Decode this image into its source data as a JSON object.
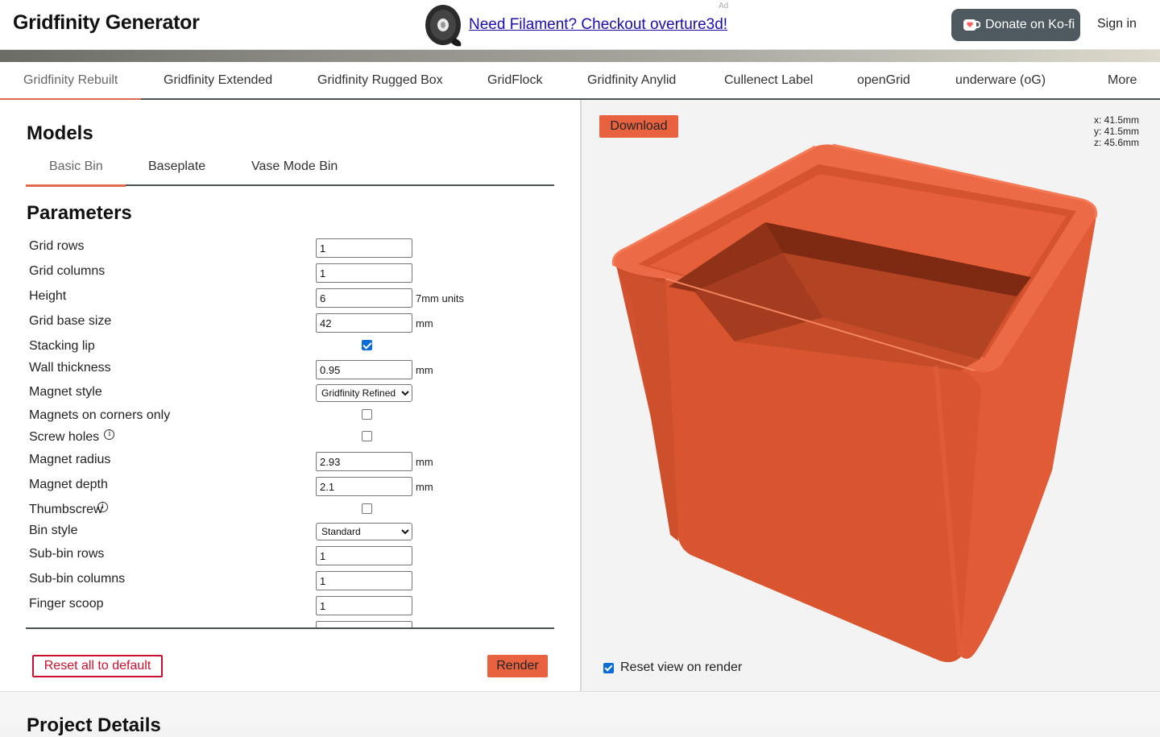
{
  "header": {
    "brand": "Gridfinity Generator",
    "ad_label": "Ad",
    "ad_link": "Need Filament? Checkout overture3d!",
    "kofi_label": "Donate on Ko-fi",
    "signin": "Sign in"
  },
  "nav": {
    "items": [
      {
        "label": "Gridfinity Rebuilt",
        "active": true
      },
      {
        "label": "Gridfinity Extended"
      },
      {
        "label": "Gridfinity Rugged Box"
      },
      {
        "label": "GridFlock"
      },
      {
        "label": "Gridfinity Anylid"
      },
      {
        "label": "Cullenect Label"
      },
      {
        "label": "openGrid"
      },
      {
        "label": "underware (oG)"
      },
      {
        "label": "More"
      }
    ]
  },
  "models": {
    "title": "Models",
    "tabs": [
      {
        "label": "Basic Bin",
        "active": true
      },
      {
        "label": "Baseplate"
      },
      {
        "label": "Vase Mode Bin"
      }
    ]
  },
  "parameters": {
    "title": "Parameters",
    "rows": [
      {
        "label": "Grid rows",
        "type": "text",
        "value": "1"
      },
      {
        "label": "Grid columns",
        "type": "text",
        "value": "1"
      },
      {
        "label": "Height",
        "type": "text",
        "value": "6",
        "unit": "7mm units"
      },
      {
        "label": "Grid base size",
        "type": "text",
        "value": "42",
        "unit": "mm"
      },
      {
        "label": "Stacking lip",
        "type": "checkbox",
        "checked": true
      },
      {
        "label": "Wall thickness",
        "type": "text",
        "value": "0.95",
        "unit": "mm"
      },
      {
        "label": "Magnet style",
        "type": "select",
        "value": "Gridfinity Refined"
      },
      {
        "label": "Magnets on corners only",
        "type": "checkbox",
        "checked": false
      },
      {
        "label": "Screw holes",
        "type": "checkbox",
        "checked": false,
        "info": true
      },
      {
        "label": "Magnet radius",
        "type": "text",
        "value": "2.93",
        "unit": "mm"
      },
      {
        "label": "Magnet depth",
        "type": "text",
        "value": "2.1",
        "unit": "mm"
      },
      {
        "label": "Thumbscrew",
        "type": "checkbox",
        "checked": false,
        "info": true
      },
      {
        "label": "Bin style",
        "type": "select",
        "value": "Standard"
      },
      {
        "label": "Sub-bin rows",
        "type": "text",
        "value": "1"
      },
      {
        "label": "Sub-bin columns",
        "type": "text",
        "value": "1"
      },
      {
        "label": "Finger scoop",
        "type": "text",
        "value": "1"
      },
      {
        "label": "",
        "type": "text",
        "value": ""
      }
    ],
    "reset_label": "Reset all to default",
    "render_label": "Render"
  },
  "viewer": {
    "download_label": "Download",
    "dims": {
      "x": "x: 41.5mm",
      "y": "y: 41.5mm",
      "z": "z: 45.6mm"
    },
    "reset_view_label": "Reset view on render",
    "reset_view_checked": true,
    "model_color": "#e25f3d"
  },
  "footer": {
    "project_title": "Project Details"
  },
  "colors": {
    "accent": "#e8623f",
    "danger": "#c8102e",
    "tab_underline": "#e06a4c"
  }
}
